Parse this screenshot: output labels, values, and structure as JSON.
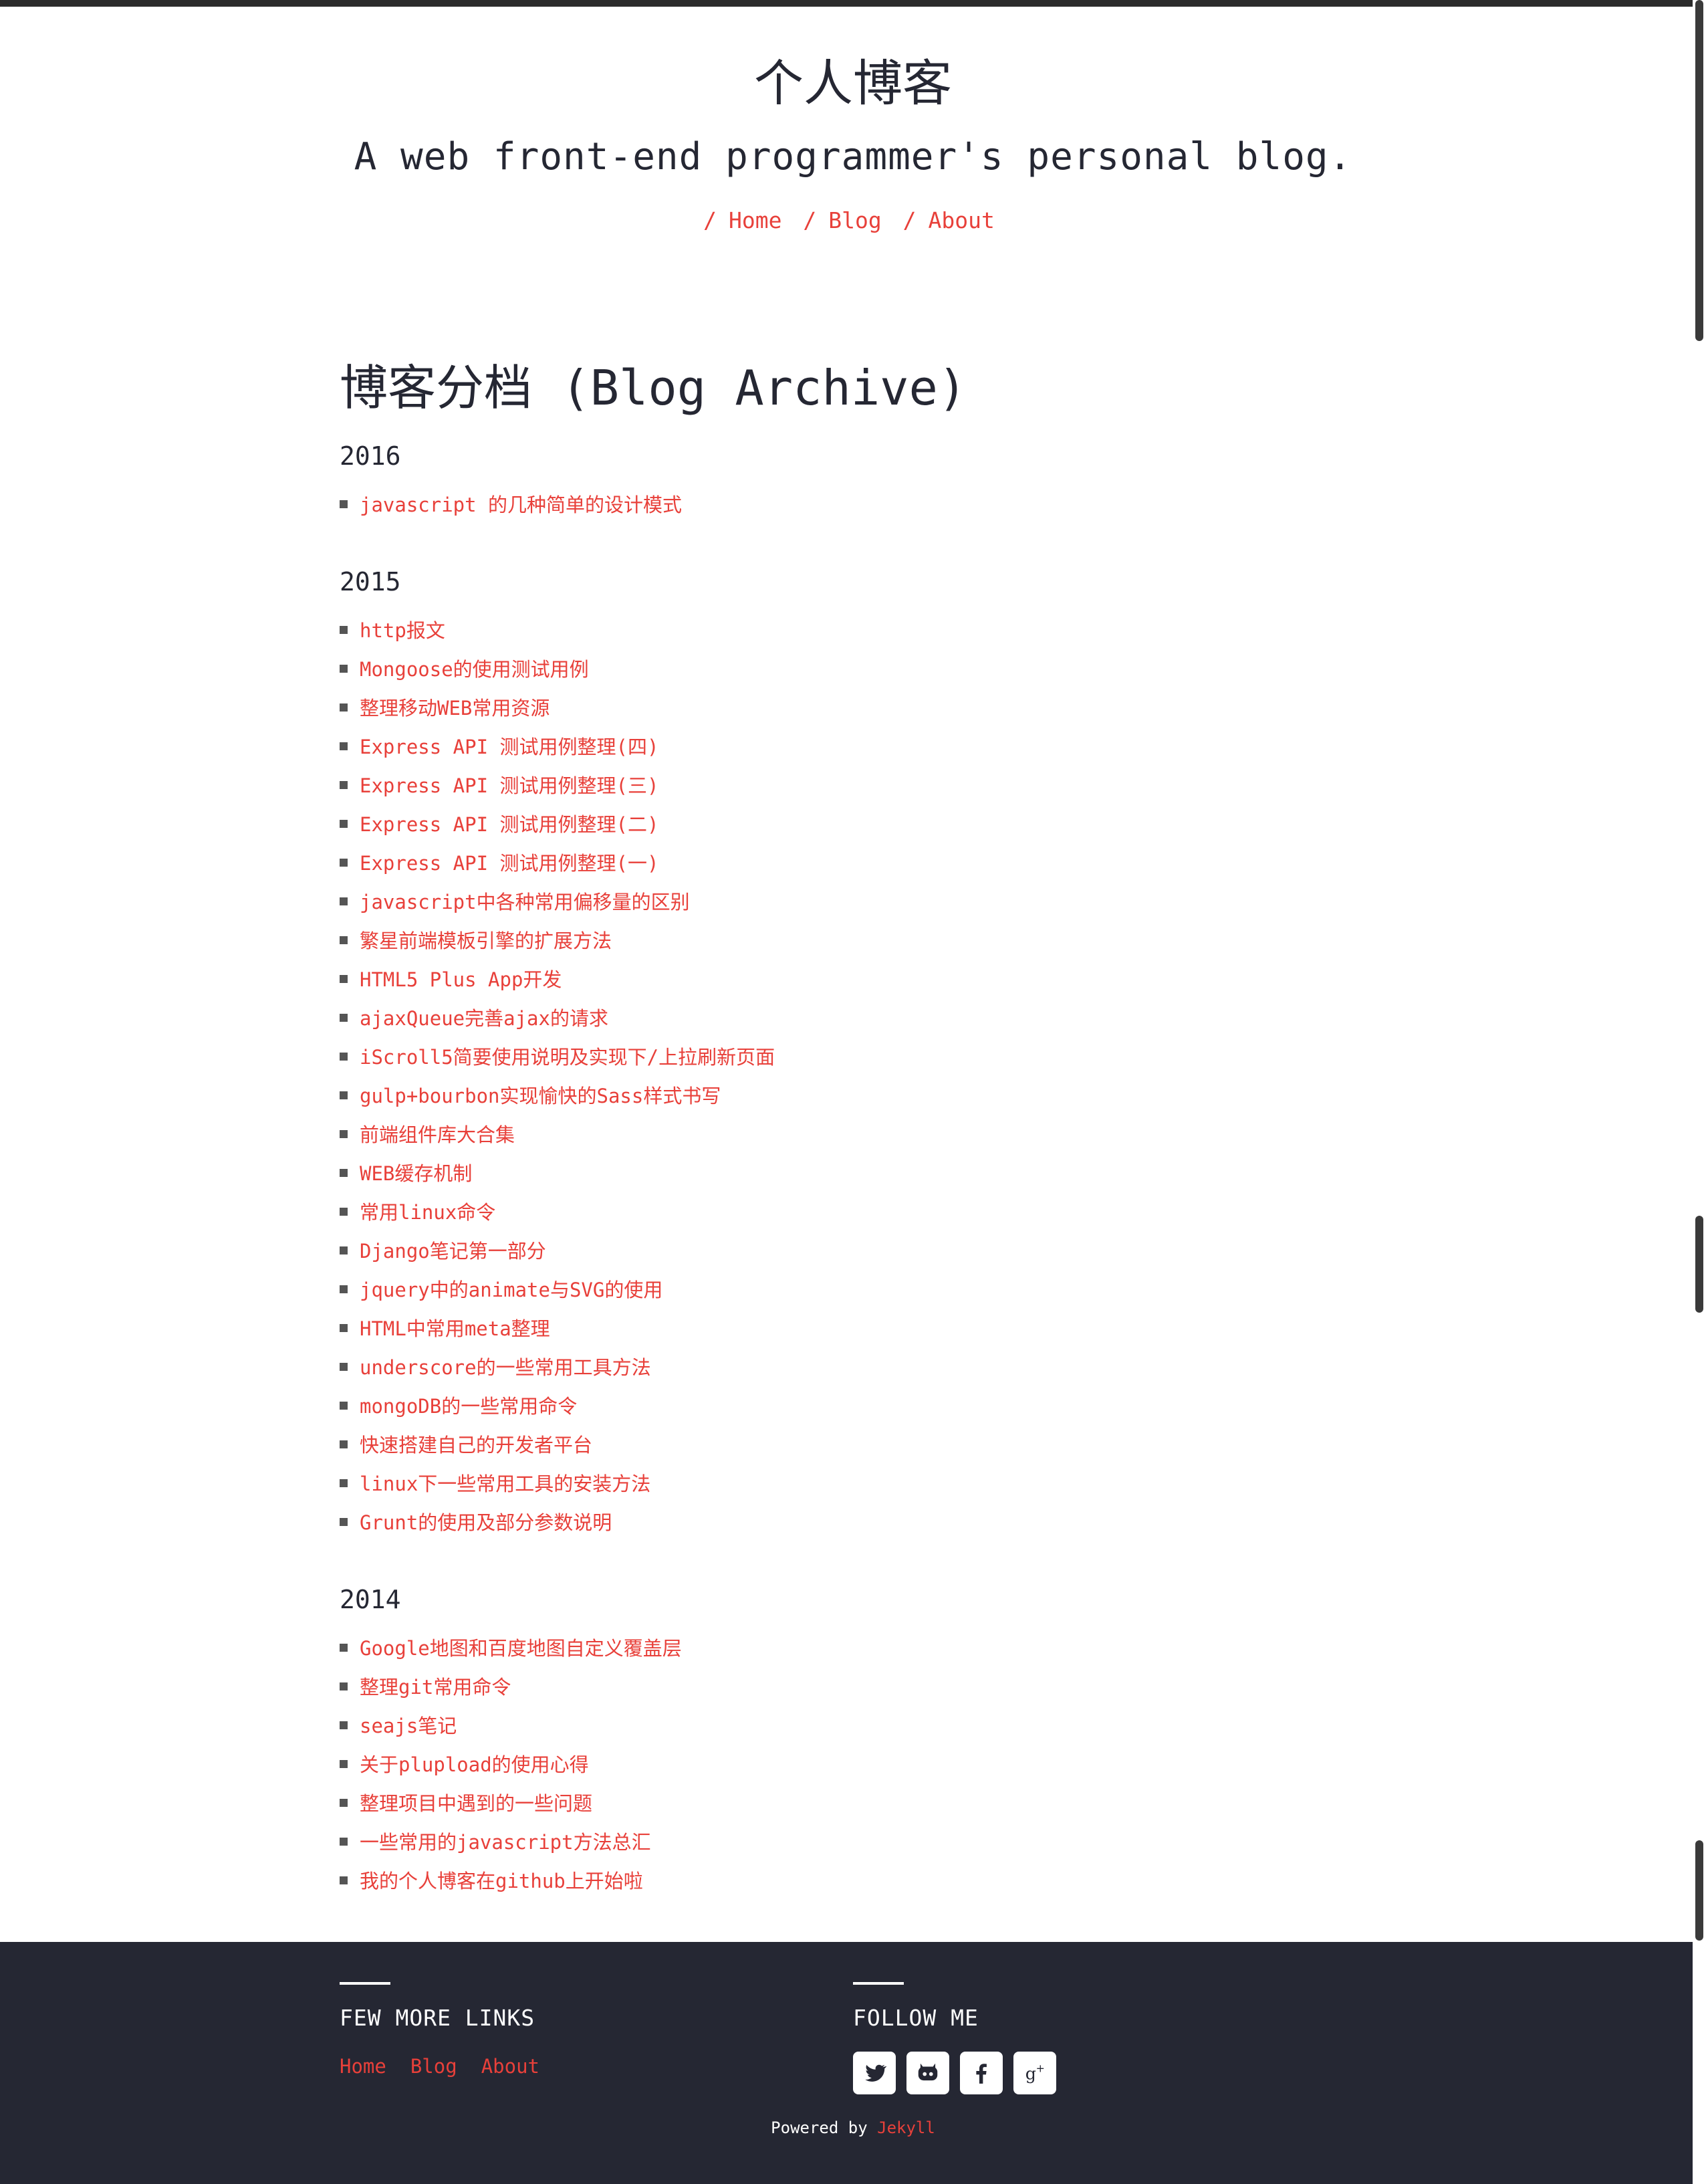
{
  "site": {
    "title": "个人博客",
    "description": "A web front-end programmer's personal blog."
  },
  "nav": {
    "slash": "/",
    "items": [
      "Home",
      "Blog",
      "About"
    ]
  },
  "page": {
    "title": "博客分档 (Blog Archive)"
  },
  "archive": [
    {
      "year": "2016",
      "posts": [
        "javascript 的几种简单的设计模式"
      ]
    },
    {
      "year": "2015",
      "posts": [
        "http报文",
        "Mongoose的使用测试用例",
        "整理移动WEB常用资源",
        "Express API 测试用例整理(四)",
        "Express API 测试用例整理(三)",
        "Express API 测试用例整理(二)",
        "Express API 测试用例整理(一)",
        "javascript中各种常用偏移量的区别",
        "繁星前端模板引擎的扩展方法",
        "HTML5 Plus App开发",
        "ajaxQueue完善ajax的请求",
        "iScroll5简要使用说明及实现下/上拉刷新页面",
        "gulp+bourbon实现愉快的Sass样式书写",
        "前端组件库大合集",
        "WEB缓存机制",
        "常用linux命令",
        "Django笔记第一部分",
        "jquery中的animate与SVG的使用",
        "HTML中常用meta整理",
        "underscore的一些常用工具方法",
        "mongoDB的一些常用命令",
        "快速搭建自己的开发者平台",
        "linux下一些常用工具的安装方法",
        "Grunt的使用及部分参数说明"
      ]
    },
    {
      "year": "2014",
      "posts": [
        "Google地图和百度地图自定义覆盖层",
        "整理git常用命令",
        "seajs笔记",
        "关于plupload的使用心得",
        "整理项目中遇到的一些问题",
        "一些常用的javascript方法总汇",
        "我的个人博客在github上开始啦"
      ]
    }
  ],
  "footer": {
    "links_heading": "FEW MORE LINKS",
    "links": [
      "Home",
      "Blog",
      "About"
    ],
    "follow_heading": "FOLLOW ME",
    "social": [
      "twitter-icon",
      "github-icon",
      "facebook-icon",
      "google-plus-icon"
    ],
    "powered_prefix": "Powered by",
    "powered_link": "Jekyll"
  },
  "colors": {
    "accent": "#e8403a",
    "text": "#252733",
    "footer_bg": "#252733"
  }
}
